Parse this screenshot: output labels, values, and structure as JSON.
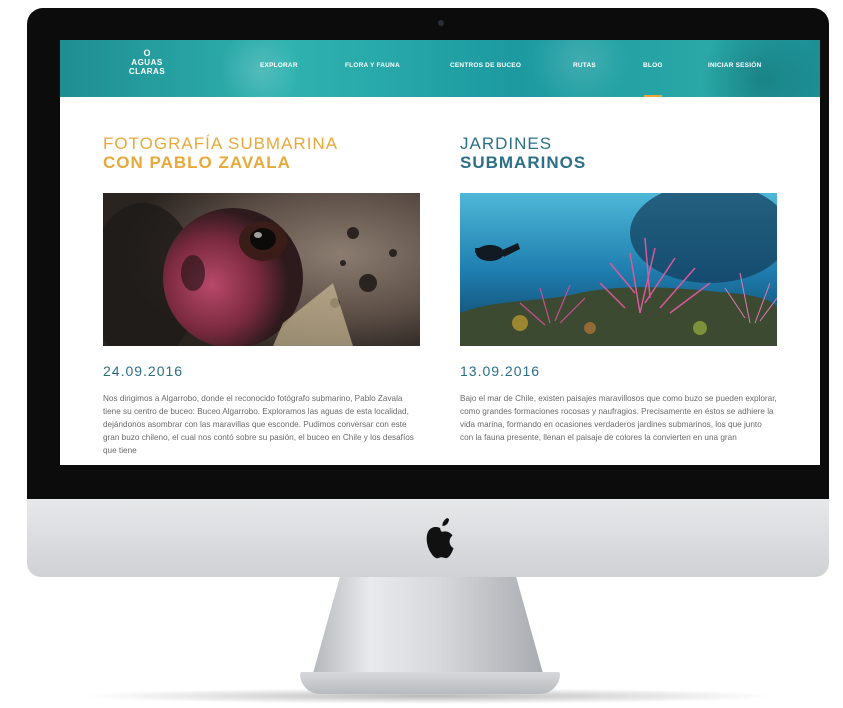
{
  "site": {
    "logo_mark": "O",
    "logo_line1": "AGUAS",
    "logo_line2": "CLARAS",
    "nav": [
      {
        "label": "EXPLORAR"
      },
      {
        "label": "FLORA Y FAUNA"
      },
      {
        "label": "CENTROS DE BUCEO"
      },
      {
        "label": "RUTAS"
      },
      {
        "label": "BLOG",
        "active": true
      },
      {
        "label": "INICIAR SESIÓN"
      }
    ]
  },
  "articles": [
    {
      "title_line1": "FOTOGRAFÍA SUBMARINA",
      "title_line2": "CON PABLO ZAVALA",
      "date": "24.09.2016",
      "text": "Nos dirigimos a Algarrobo, donde el reconocido fotógrafo submarino, Pablo Zavala tiene su centro de buceo: Buceo Algarrobo. Exploramos las aguas de esta localidad, dejándonos asombrar con las maravillas que esconde. Pudimos conversar con este gran buzo chileno, el cual nos contó sobre su pasión, el buceo en Chile y los desafíos que tiene"
    },
    {
      "title_line1": "JARDINES",
      "title_line2": "SUBMARINOS",
      "date": "13.09.2016",
      "text": "Bajo el mar de Chile, existen paisajes maravillosos que como buzo se pueden explorar, como grandes formaciones rocosas y naufragios. Precisamente en éstos se adhiere la vida marina, formando en ocasiones verdaderos jardines submarinos, los que junto con la fauna presente, llenan el paisaje de colores la convierten en una gran"
    }
  ],
  "colors": {
    "accent_gold": "#e8a93a",
    "accent_teal": "#2c6f88",
    "header_teal": "#1f9ba0"
  },
  "icons": {
    "device_logo": "apple-logo-icon",
    "camera": "camera-dot-icon"
  }
}
